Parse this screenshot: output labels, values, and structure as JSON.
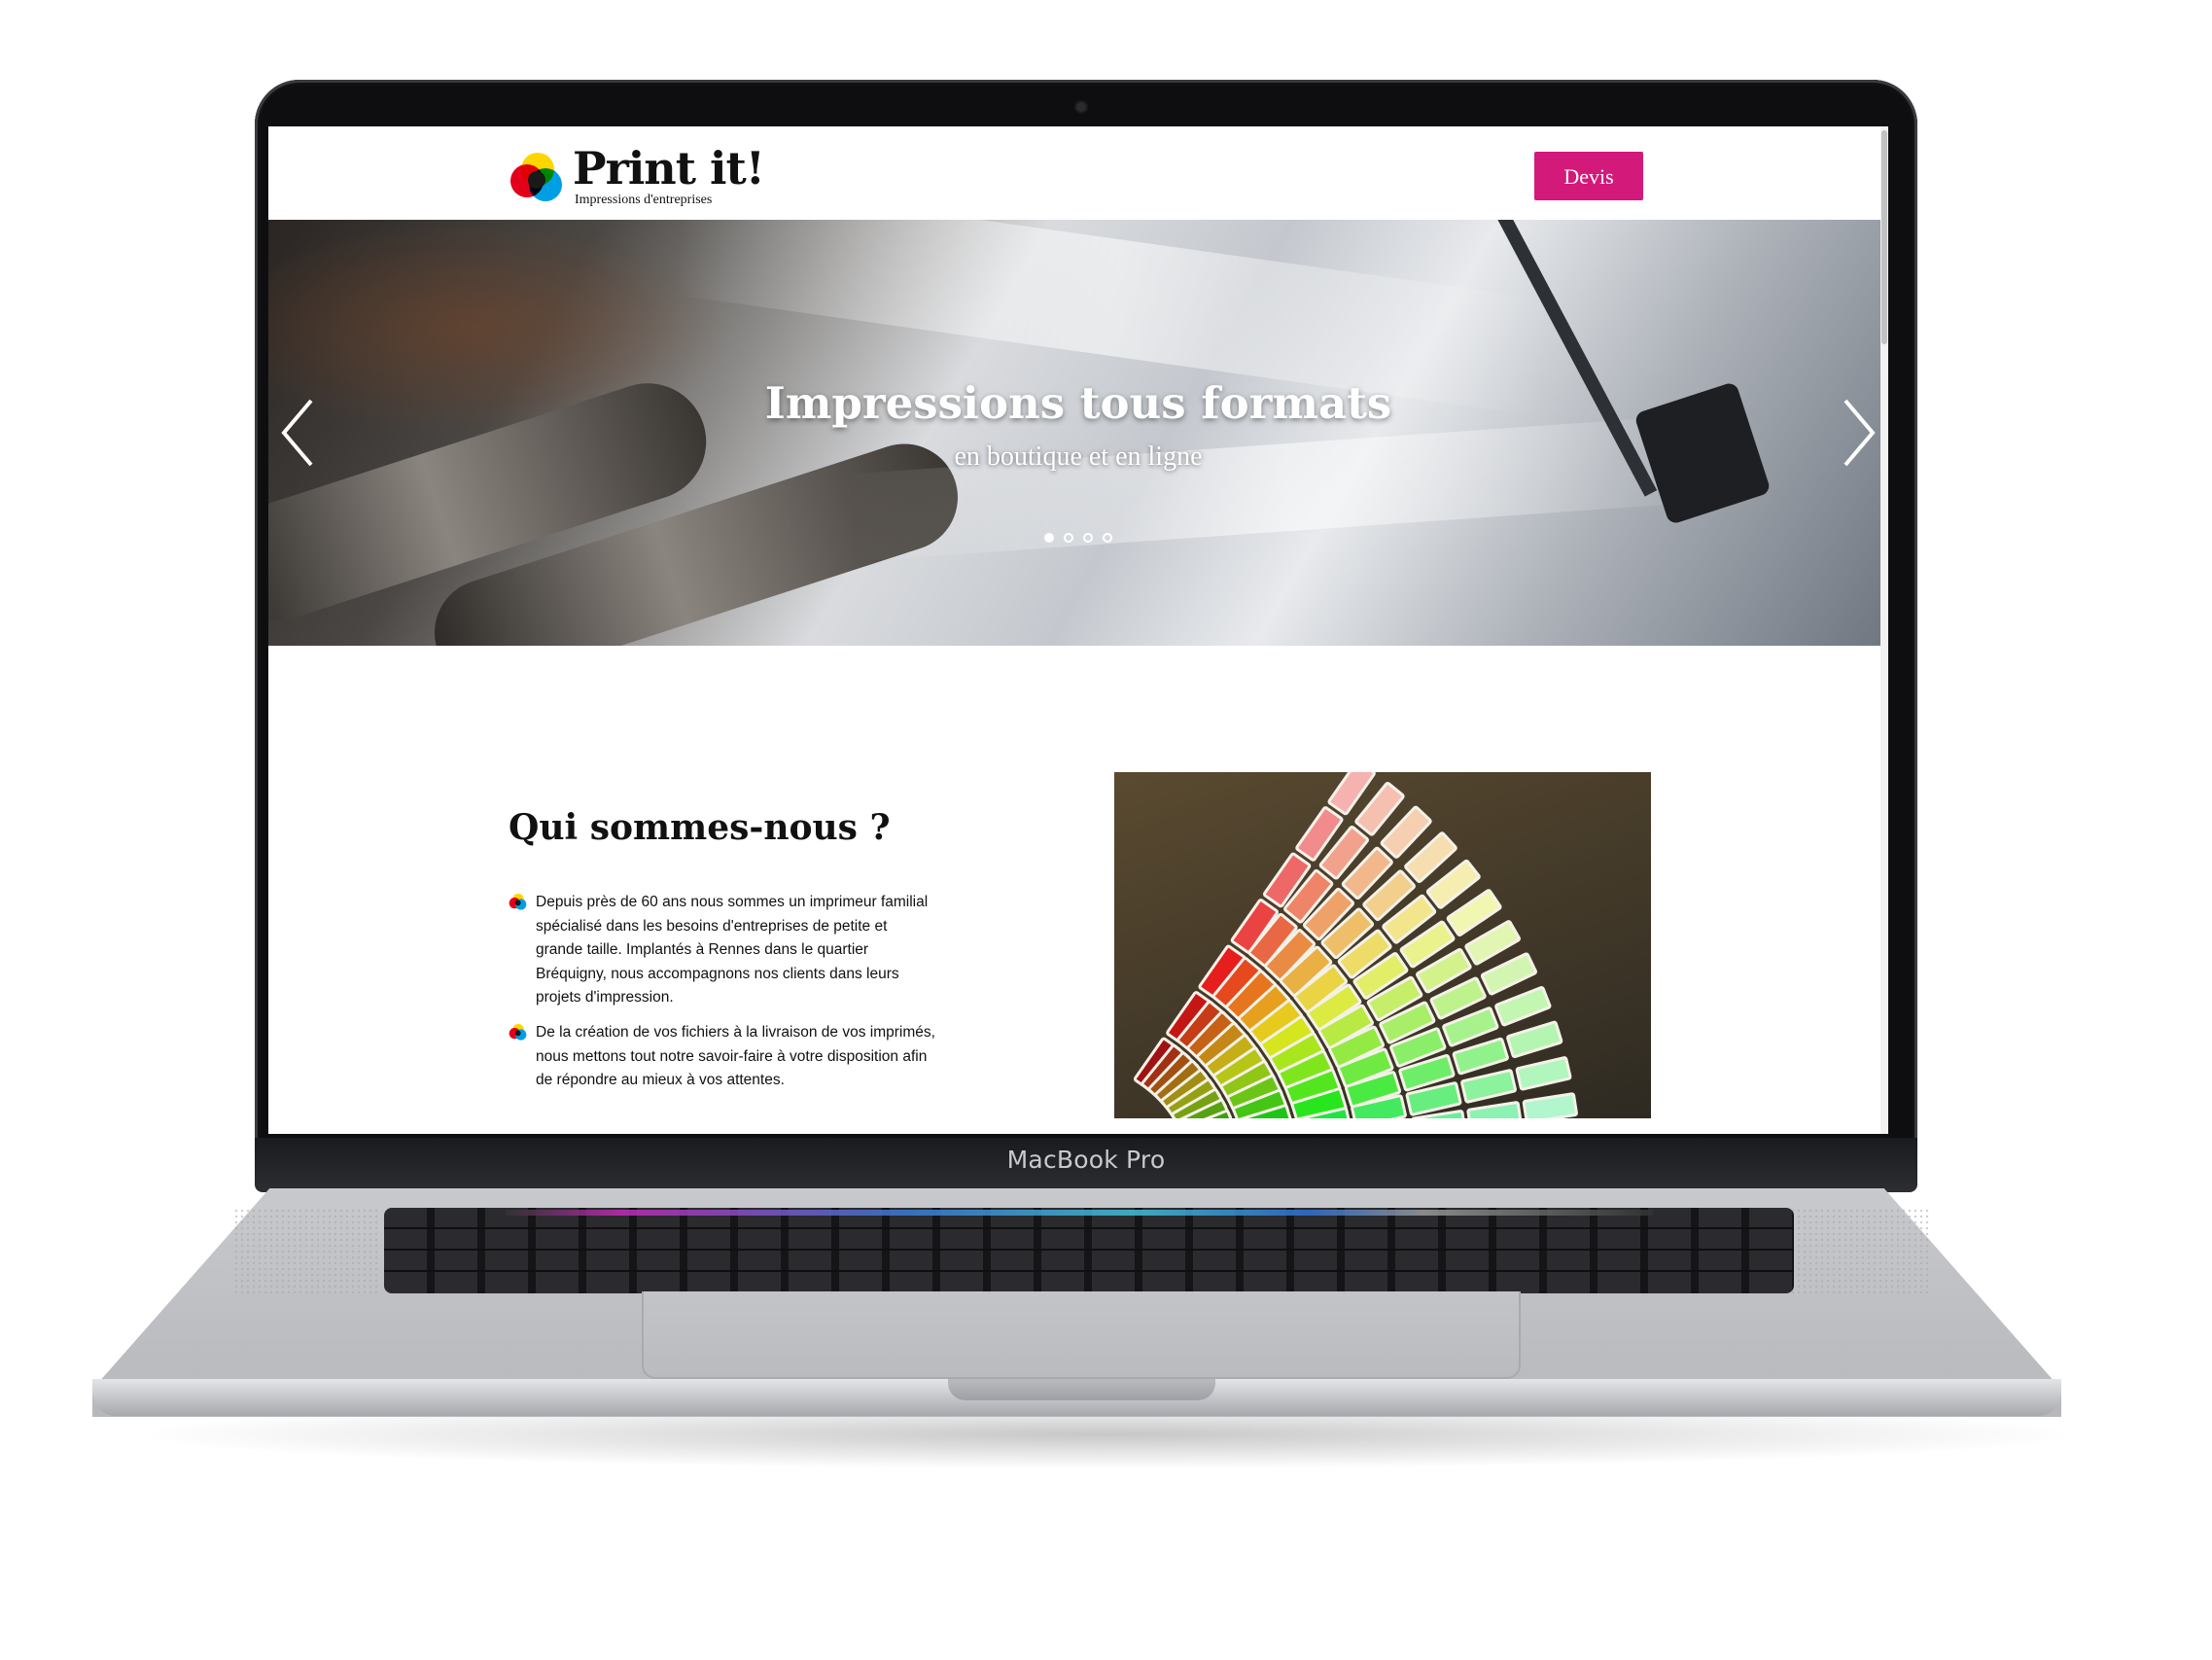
{
  "device": {
    "label": "MacBook Pro"
  },
  "site": {
    "logo": {
      "title": "Print it!",
      "subtitle": "Impressions d'entreprises",
      "colors": [
        "#e2001a",
        "#ffd500",
        "#009fe3",
        "#1a1a1a"
      ]
    },
    "header": {
      "devis_label": "Devis",
      "devis_color": "#d3197a"
    },
    "hero": {
      "title": "Impressions tous formats",
      "subtitle": "en boutique et en ligne",
      "prev_icon": "chevron-left-icon",
      "next_icon": "chevron-right-icon",
      "slide_count": 4,
      "active_slide": 1
    },
    "about": {
      "title": "Qui sommes-nous ?",
      "bullets": [
        {
          "icon": "logo-dots-icon",
          "text": "Depuis près de 60 ans nous sommes un imprimeur familial spécialisé dans les besoins d'entreprises de petite et grande taille. Implantés à Rennes dans le quartier Bréquigny, nous accompagnons nos clients dans leurs projets d'impression."
        },
        {
          "icon": "logo-dots-icon",
          "text": "De la création de vos fichiers à la livraison de vos imprimés, nous mettons tout notre savoir-faire à votre disposition afin de répondre au mieux à vos attentes."
        }
      ],
      "image": "color-swatch-fan-image"
    }
  }
}
